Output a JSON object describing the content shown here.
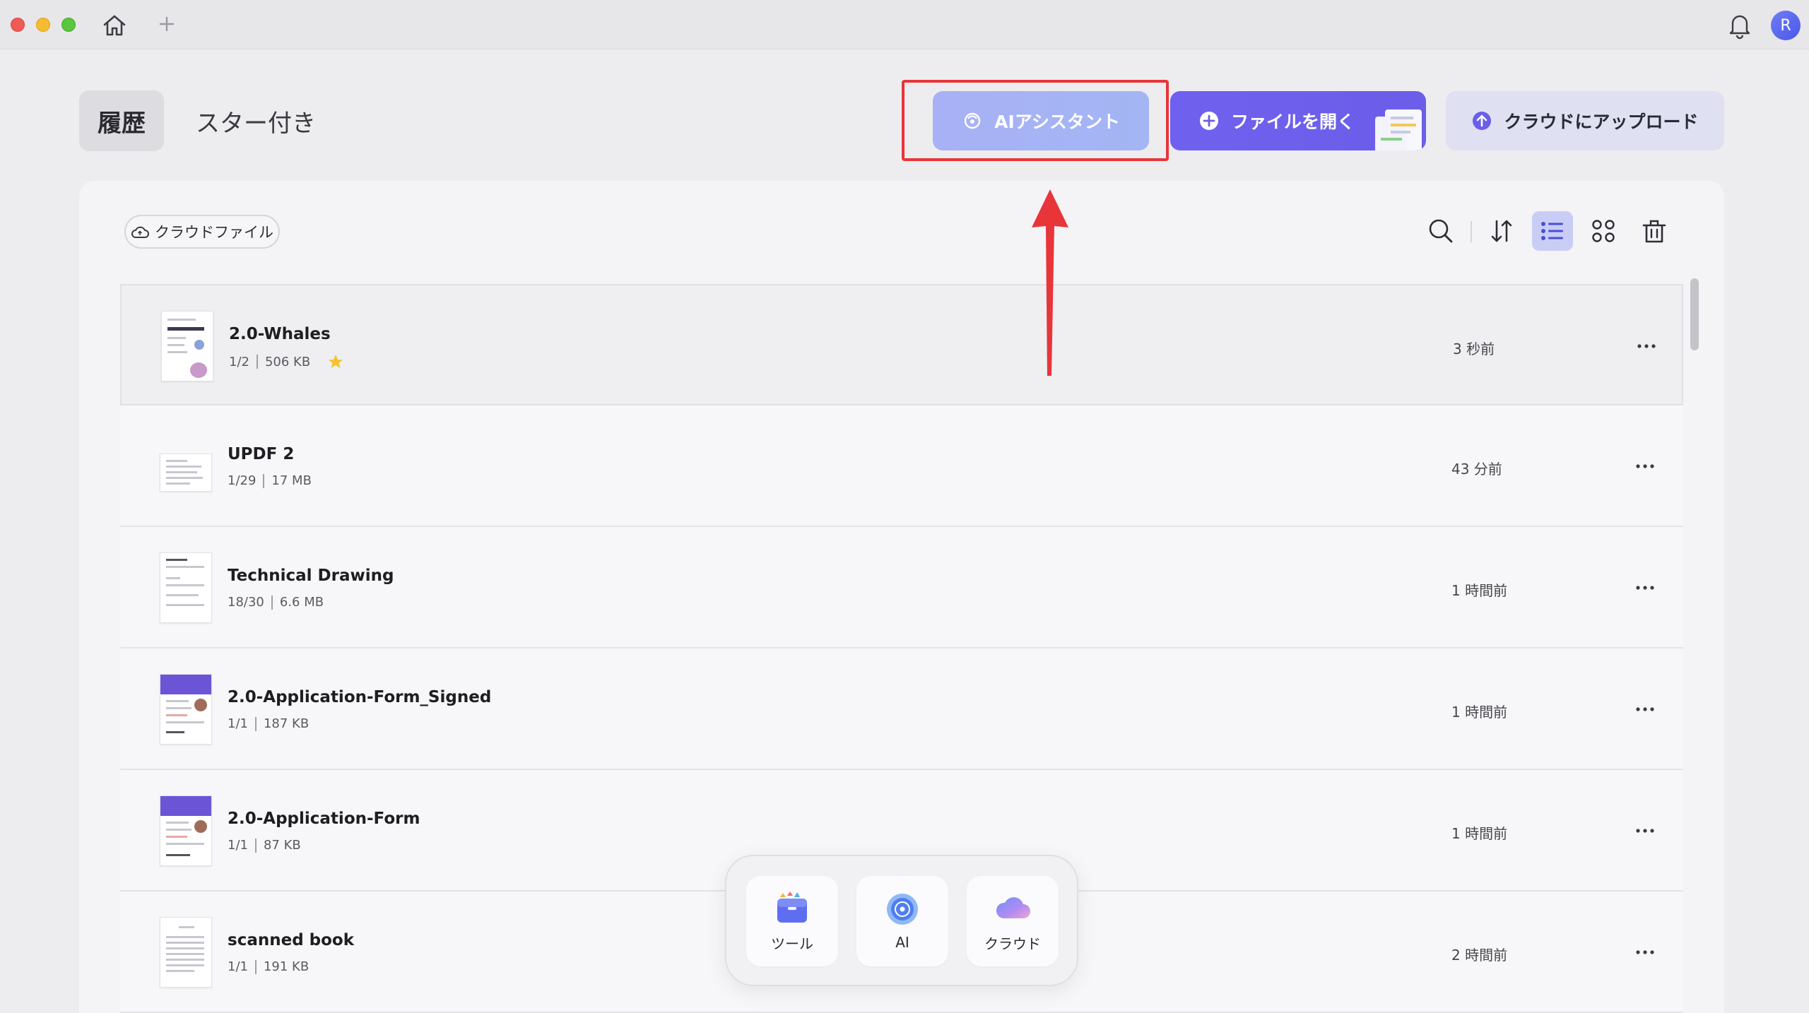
{
  "titlebar": {
    "avatar_initial": "R"
  },
  "tabs": {
    "history": "履歴",
    "starred": "スター付き"
  },
  "actions": {
    "ai_assistant": "AIアシスタント",
    "open_file": "ファイルを開く",
    "upload_cloud": "クラウドにアップロード"
  },
  "toolbar": {
    "cloud_files": "クラウドファイル"
  },
  "files": [
    {
      "name": "2.0-Whales",
      "pages": "1/2",
      "size": "506 KB",
      "time": "3 秒前",
      "starred": true
    },
    {
      "name": "UPDF 2",
      "pages": "1/29",
      "size": "17 MB",
      "time": "43 分前",
      "starred": false
    },
    {
      "name": "Technical Drawing",
      "pages": "18/30",
      "size": "6.6 MB",
      "time": "1 時間前",
      "starred": false
    },
    {
      "name": "2.0-Application-Form_Signed",
      "pages": "1/1",
      "size": "187 KB",
      "time": "1 時間前",
      "starred": false
    },
    {
      "name": "2.0-Application-Form",
      "pages": "1/1",
      "size": "87 KB",
      "time": "1 時間前",
      "starred": false
    },
    {
      "name": "scanned book",
      "pages": "1/1",
      "size": "191 KB",
      "time": "2 時間前",
      "starred": false
    }
  ],
  "dock": {
    "tools": "ツール",
    "ai": "AI",
    "cloud": "クラウド"
  },
  "colors": {
    "accent": "#6b5ee8",
    "ai_button": "#a8b1f5",
    "highlight": "#e8353a",
    "star": "#f4c430"
  }
}
